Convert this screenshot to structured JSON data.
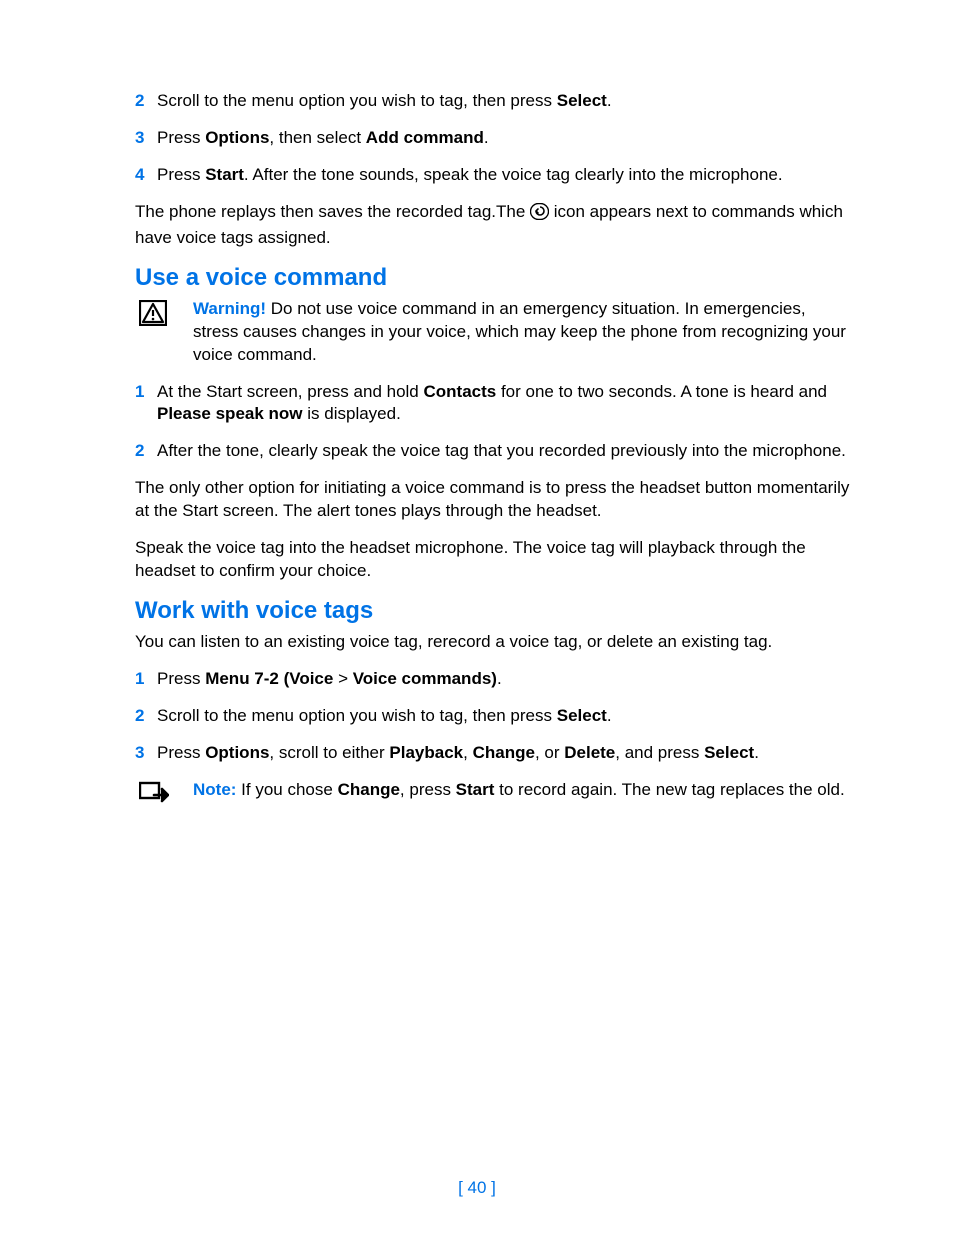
{
  "list1": {
    "n2": "2",
    "n3": "3",
    "n4": "4",
    "t2a": "Scroll to the menu option you wish to tag, then press ",
    "t2b": "Select",
    "t2c": ".",
    "t3a": "Press ",
    "t3b": "Options",
    "t3c": ", then select ",
    "t3d": "Add command",
    "t3e": ".",
    "t4a": "Press ",
    "t4b": "Start",
    "t4c": ". After the tone sounds, speak the voice tag clearly into the microphone."
  },
  "para1a": "The phone replays then saves the recorded tag.The ",
  "para1b": " icon appears next to commands which have voice tags assigned.",
  "h2a": "Use a voice command",
  "warn": {
    "label": "Warning!",
    "text": " Do not use voice command in an emergency situation. In emergencies, stress causes changes in your voice, which may keep the phone from recognizing your voice command."
  },
  "list2": {
    "n1": "1",
    "n2": "2",
    "t1a": "At the Start screen, press and hold ",
    "t1b": "Contacts",
    "t1c": " for one to two seconds. A tone is heard and ",
    "t1d": "Please speak now",
    "t1e": " is displayed.",
    "t2": "After the tone, clearly speak the voice tag that you recorded previously into the microphone."
  },
  "para2": "The only other option for initiating a voice command is to press the headset button momentarily at the Start screen. The alert tones plays through the headset.",
  "para3": "Speak the voice tag into the headset microphone. The voice tag will playback through the headset to confirm your choice.",
  "h2b": "Work with voice tags",
  "para4": "You can listen to an existing voice tag, rerecord a voice tag, or delete an existing tag.",
  "list3": {
    "n1": "1",
    "n2": "2",
    "n3": "3",
    "t1a": "Press ",
    "t1b": "Menu 7-2 (Voice",
    "t1c": " > ",
    "t1d": "Voice commands)",
    "t1e": ".",
    "t2a": "Scroll to the menu option you wish to tag, then press ",
    "t2b": "Select",
    "t2c": ".",
    "t3a": "Press ",
    "t3b": "Options",
    "t3c": ", scroll to either ",
    "t3d": "Playback",
    "t3e": ", ",
    "t3f": "Change",
    "t3g": ", or ",
    "t3h": "Delete",
    "t3i": ", and press ",
    "t3j": "Select",
    "t3k": "."
  },
  "note": {
    "label": "Note:",
    "a": " If you chose ",
    "b": "Change",
    "c": ", press ",
    "d": "Start",
    "e": " to record again. The new tag replaces the old."
  },
  "footer": "[ 40 ]"
}
